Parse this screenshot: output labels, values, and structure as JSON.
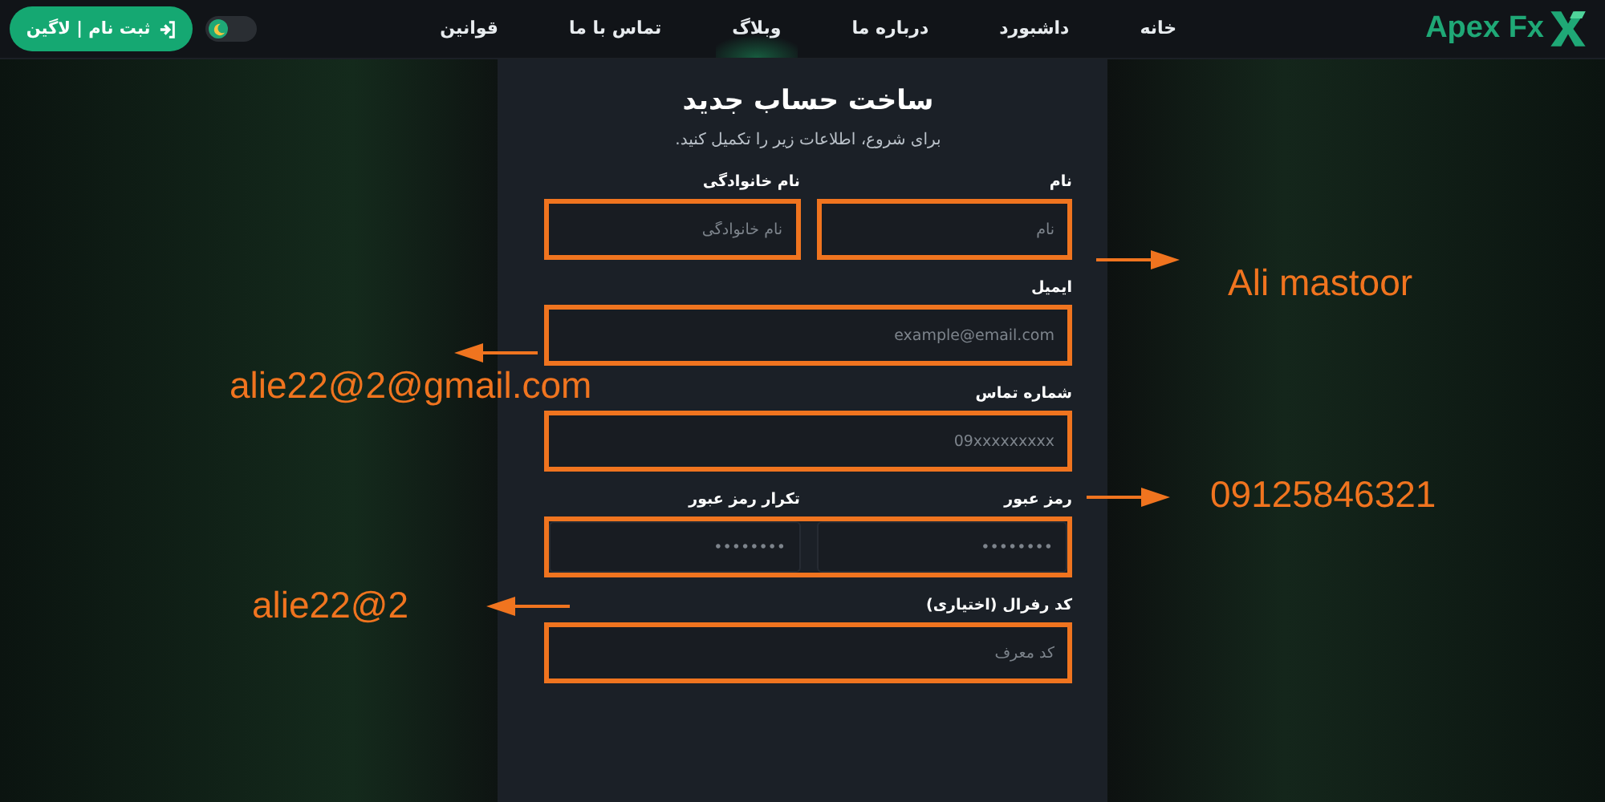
{
  "header": {
    "logo": "Apex Fx",
    "nav": [
      {
        "label": "خانه",
        "selected": false
      },
      {
        "label": "داشبورد",
        "selected": false
      },
      {
        "label": "درباره ما",
        "selected": false
      },
      {
        "label": "وبلاگ",
        "selected": true
      },
      {
        "label": "تماس با ما",
        "selected": false
      },
      {
        "label": "قوانین",
        "selected": false
      }
    ],
    "theme_toggle": {
      "light_mode": false
    },
    "login_button": "ثبت نام | لاگین"
  },
  "form": {
    "title": "ساخت حساب جدید",
    "subtitle": "برای شروع، اطلاعات زیر را تکمیل کنید.",
    "rows": [
      {
        "kind": "split",
        "fields": [
          {
            "label": "نام",
            "placeholder": "نام",
            "highlighted": true
          },
          {
            "label": "نام خانوادگی",
            "placeholder": "نام خانوادگی",
            "highlighted": true
          }
        ]
      },
      {
        "kind": "split",
        "fields": [
          {
            "label": "ایمیل",
            "placeholder": "example@email.com",
            "highlighted": true
          }
        ]
      },
      {
        "kind": "split",
        "fields": [
          {
            "label": "شماره تماس",
            "placeholder": "09xxxxxxxxx",
            "highlighted": true
          }
        ]
      },
      {
        "kind": "joined",
        "highlighted": true,
        "fields": [
          {
            "label": "رمز عبور",
            "placeholder": "••••••••"
          },
          {
            "label": "تکرار رمز عبور",
            "placeholder": "••••••••"
          }
        ]
      },
      {
        "kind": "split",
        "fields": [
          {
            "label": "کد رفرال (اختیاری)",
            "placeholder": "کد معرف",
            "highlighted": true
          }
        ]
      }
    ]
  },
  "annotations": [
    {
      "text": "Ali mastoor",
      "kind": "right"
    },
    {
      "text": "alie22@2@gmail.com",
      "kind": "left"
    },
    {
      "text": "09125846321",
      "kind": "right"
    },
    {
      "text": "alie22@2",
      "kind": "left"
    }
  ]
}
